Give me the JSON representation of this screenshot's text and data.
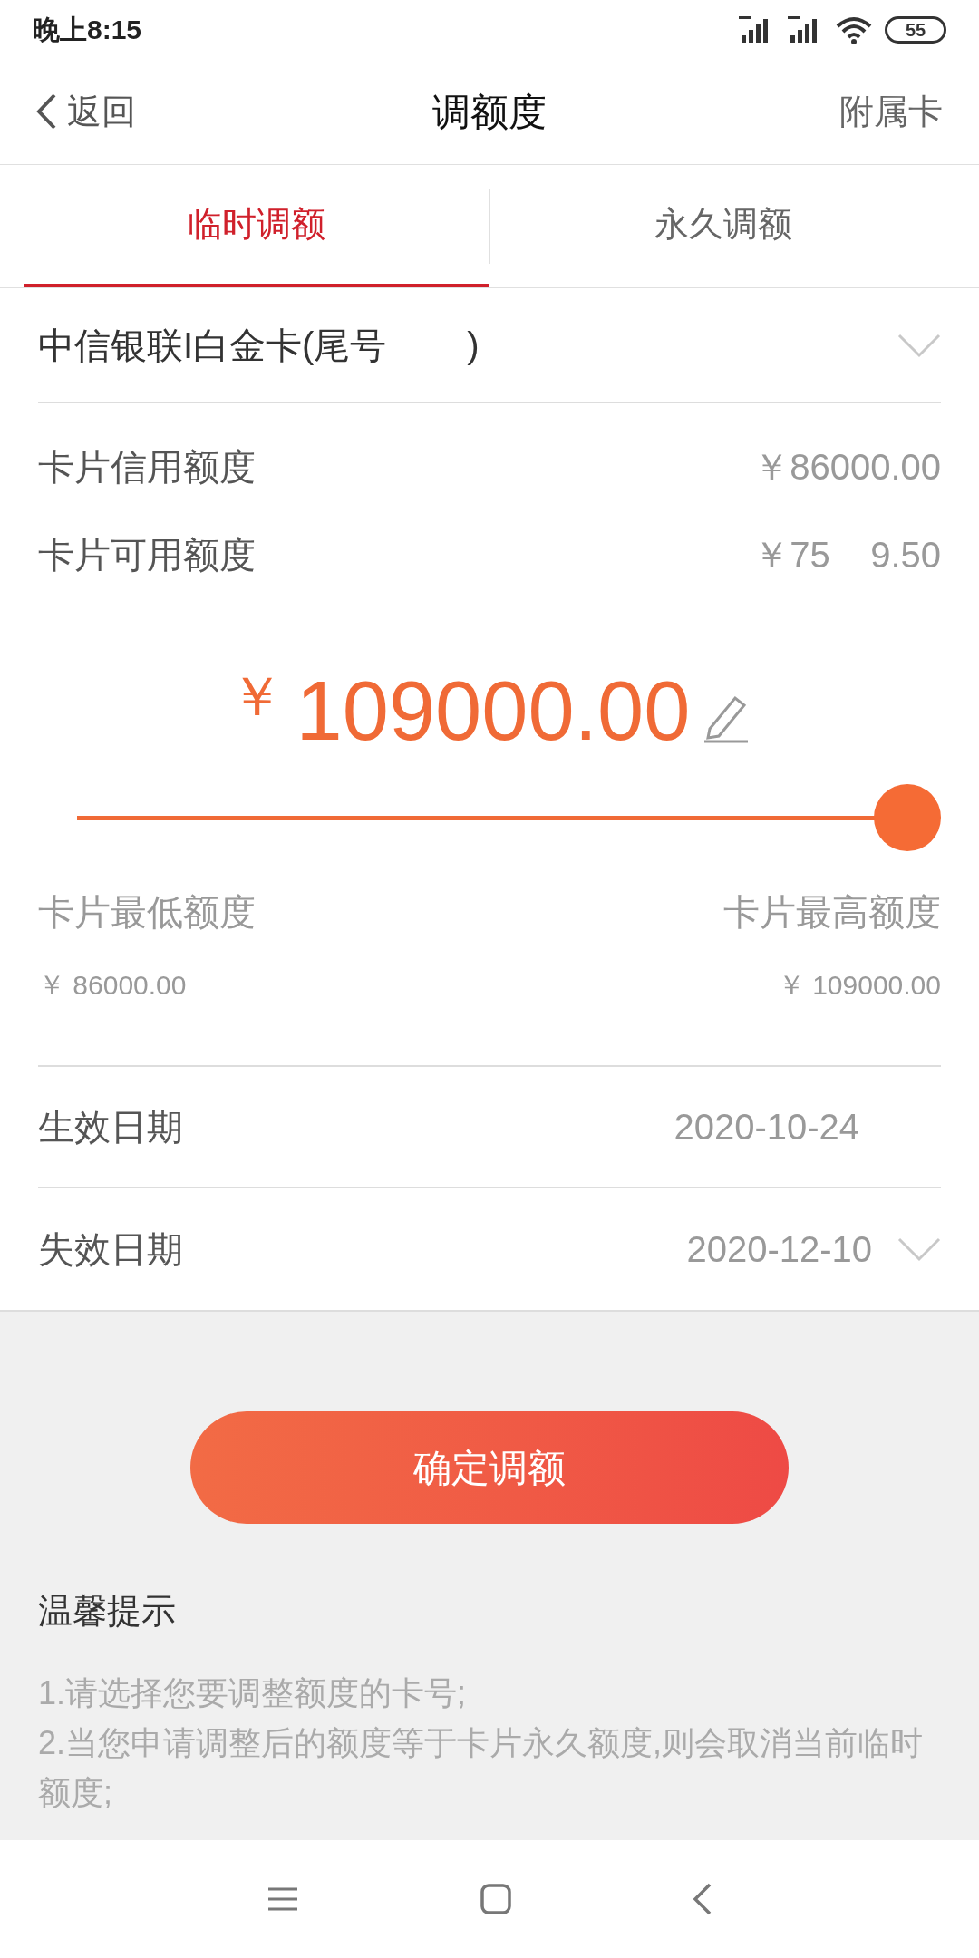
{
  "status_bar": {
    "time": "晚上8:15",
    "battery": "55"
  },
  "nav": {
    "back": "返回",
    "title": "调额度",
    "action": "附属卡"
  },
  "tabs": [
    {
      "label": "临时调额",
      "selected": true
    },
    {
      "label": "永久调额",
      "selected": false
    }
  ],
  "card_select": {
    "value": "中信银联I白金卡(尾号        )"
  },
  "limits": [
    {
      "label": "卡片信用额度",
      "value": "￥86000.00"
    },
    {
      "label": "卡片可用额度",
      "value": "￥75    9.50"
    }
  ],
  "amount": {
    "currency": "￥",
    "value": "109000.00"
  },
  "slider": {
    "level": 1,
    "min_label": "卡片最低额度",
    "min_value": "￥ 86000.00",
    "max_label": "卡片最高额度",
    "max_value": "￥ 109000.00"
  },
  "dates": [
    {
      "label": "生效日期",
      "value": "2020-10-24",
      "dropdown": false
    },
    {
      "label": "失效日期",
      "value": "2020-12-10",
      "dropdown": true
    }
  ],
  "confirm_button": "确定调额",
  "tips": {
    "title": "温馨提示",
    "lines": [
      "1.请选择您要调整额度的卡号;",
      "2.当您申请调整后的额度等于卡片永久额度,则会取消当前临时额度;"
    ]
  }
}
